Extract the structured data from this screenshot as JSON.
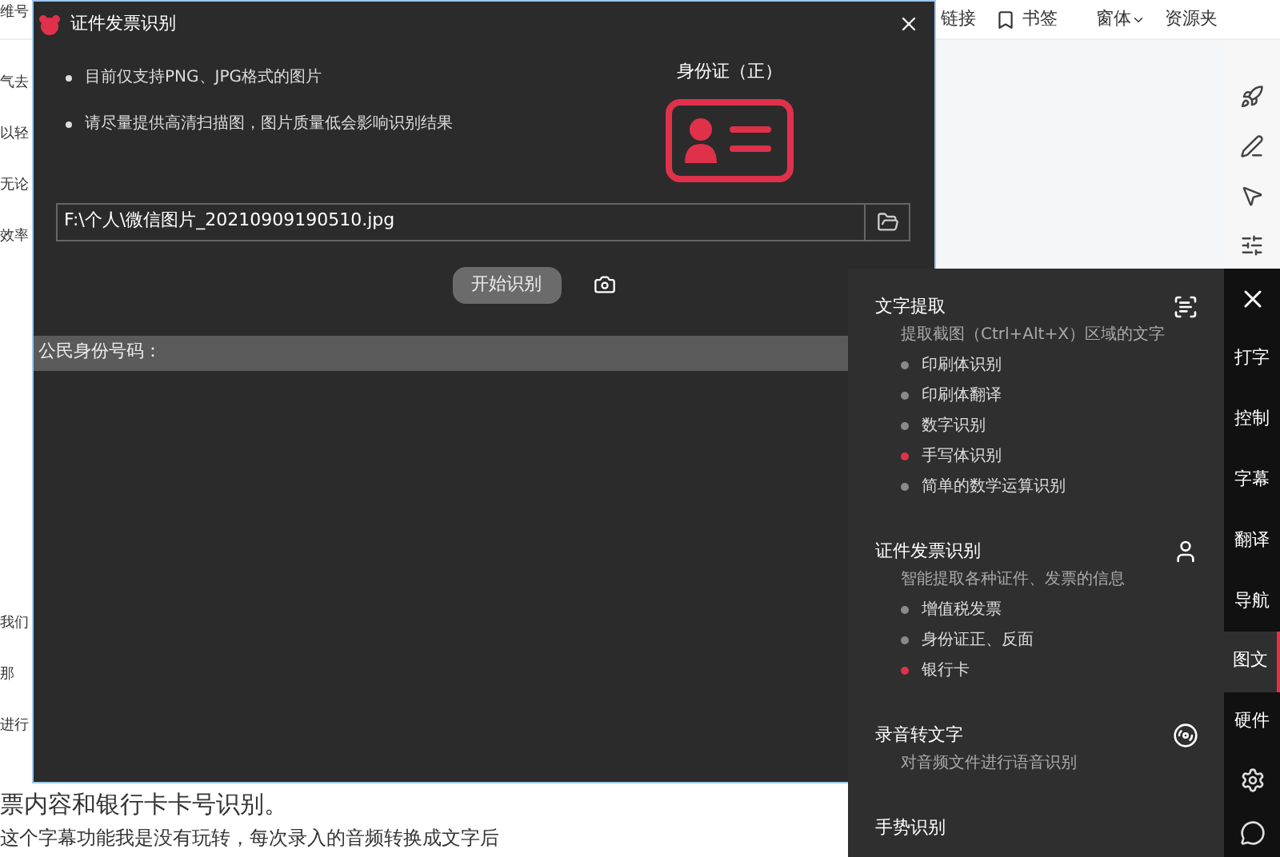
{
  "ribbon": {
    "items": [
      "链接",
      "书签",
      "窗体",
      "资源夹"
    ]
  },
  "document": {
    "top_fragment": "维号",
    "upper_fragments": [
      "气去",
      "以轻",
      "无论",
      "效率"
    ],
    "lower_fragments": [
      "我们",
      "那",
      "进行"
    ],
    "lines": [
      "票内容和银行卡卡号识别。",
      "这个字幕功能我是没有玩转，每次录入的音频转换成文字后"
    ]
  },
  "dialog": {
    "title": "证件发票识别",
    "tips": [
      "目前仅支持PNG、JPG格式的图片",
      "请尽量提供高清扫描图，图片质量低会影响识别结果"
    ],
    "card_label": "身份证（正）",
    "file_path": "F:\\个人\\微信图片_20210909190510.jpg",
    "start_button": "开始识别",
    "result_label": "公民身份号码："
  },
  "panel": {
    "sections": [
      {
        "kind": "scan",
        "title": "文字提取",
        "description": "提取截图（Ctrl+Alt+X）区域的文字",
        "items": [
          {
            "label": "印刷体识别",
            "color": "#8a8a8a"
          },
          {
            "label": "印刷体翻译",
            "color": "#8a8a8a"
          },
          {
            "label": "数字识别",
            "color": "#8a8a8a"
          },
          {
            "label": "手写体识别",
            "color": "#e0314b"
          },
          {
            "label": "简单的数学运算识别",
            "color": "#8a8a8a"
          }
        ]
      },
      {
        "kind": "person",
        "title": "证件发票识别",
        "description": "智能提取各种证件、发票的信息",
        "items": [
          {
            "label": "增值税发票",
            "color": "#8a8a8a"
          },
          {
            "label": "身份证正、反面",
            "color": "#8a8a8a"
          },
          {
            "label": "银行卡",
            "color": "#e0314b"
          }
        ]
      },
      {
        "kind": "reel",
        "title": "录音转文字",
        "description": "对音频文件进行语音识别"
      },
      {
        "kind": "none",
        "title": "手势识别"
      }
    ]
  },
  "sidebar": {
    "items": [
      {
        "kind": "close"
      },
      {
        "kind": "text",
        "label": "打字",
        "selected": false
      },
      {
        "kind": "text",
        "label": "控制",
        "selected": false
      },
      {
        "kind": "text",
        "label": "字幕",
        "selected": false
      },
      {
        "kind": "text",
        "label": "翻译",
        "selected": false
      },
      {
        "kind": "text",
        "label": "导航",
        "selected": false
      },
      {
        "kind": "text",
        "label": "图文",
        "selected": true
      },
      {
        "kind": "text",
        "label": "硬件",
        "selected": false
      },
      {
        "kind": "settings"
      },
      {
        "kind": "chat"
      }
    ]
  }
}
